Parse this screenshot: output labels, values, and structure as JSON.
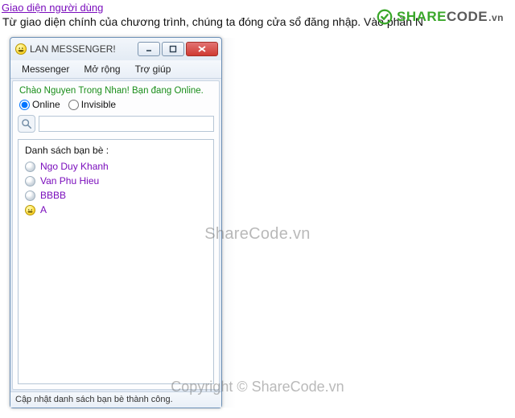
{
  "page": {
    "heading_link": "Giao diện người dùng",
    "intro_text": "Từ giao diện chính của chương trình, chúng ta đóng cửa sổ đăng nhập. Vào phần N"
  },
  "brand": {
    "share": "SHARE",
    "code": "CODE",
    "suffix": ".vn"
  },
  "window": {
    "title": "LAN MESSENGER!",
    "menu": {
      "messenger": "Messenger",
      "morong": "Mở rộng",
      "trogiup": "Trợ giúp"
    },
    "greeting": "Chào Nguyen Trong Nhan! Bạn đang Online.",
    "status": {
      "online_label": "Online",
      "invisible_label": "Invisible",
      "selected": "online"
    },
    "search_value": "",
    "buddylist_header": "Danh sách bạn bè :",
    "buddies": [
      {
        "name": "Ngo Duy Khanh",
        "state": "offline"
      },
      {
        "name": "Van Phu Hieu",
        "state": "offline"
      },
      {
        "name": "BBBB",
        "state": "offline"
      },
      {
        "name": "A",
        "state": "online"
      }
    ],
    "statusbar": "Cập nhật danh sách bạn bè thành công."
  },
  "watermarks": {
    "center": "ShareCode.vn",
    "bottom": "Copyright © ShareCode.vn"
  }
}
